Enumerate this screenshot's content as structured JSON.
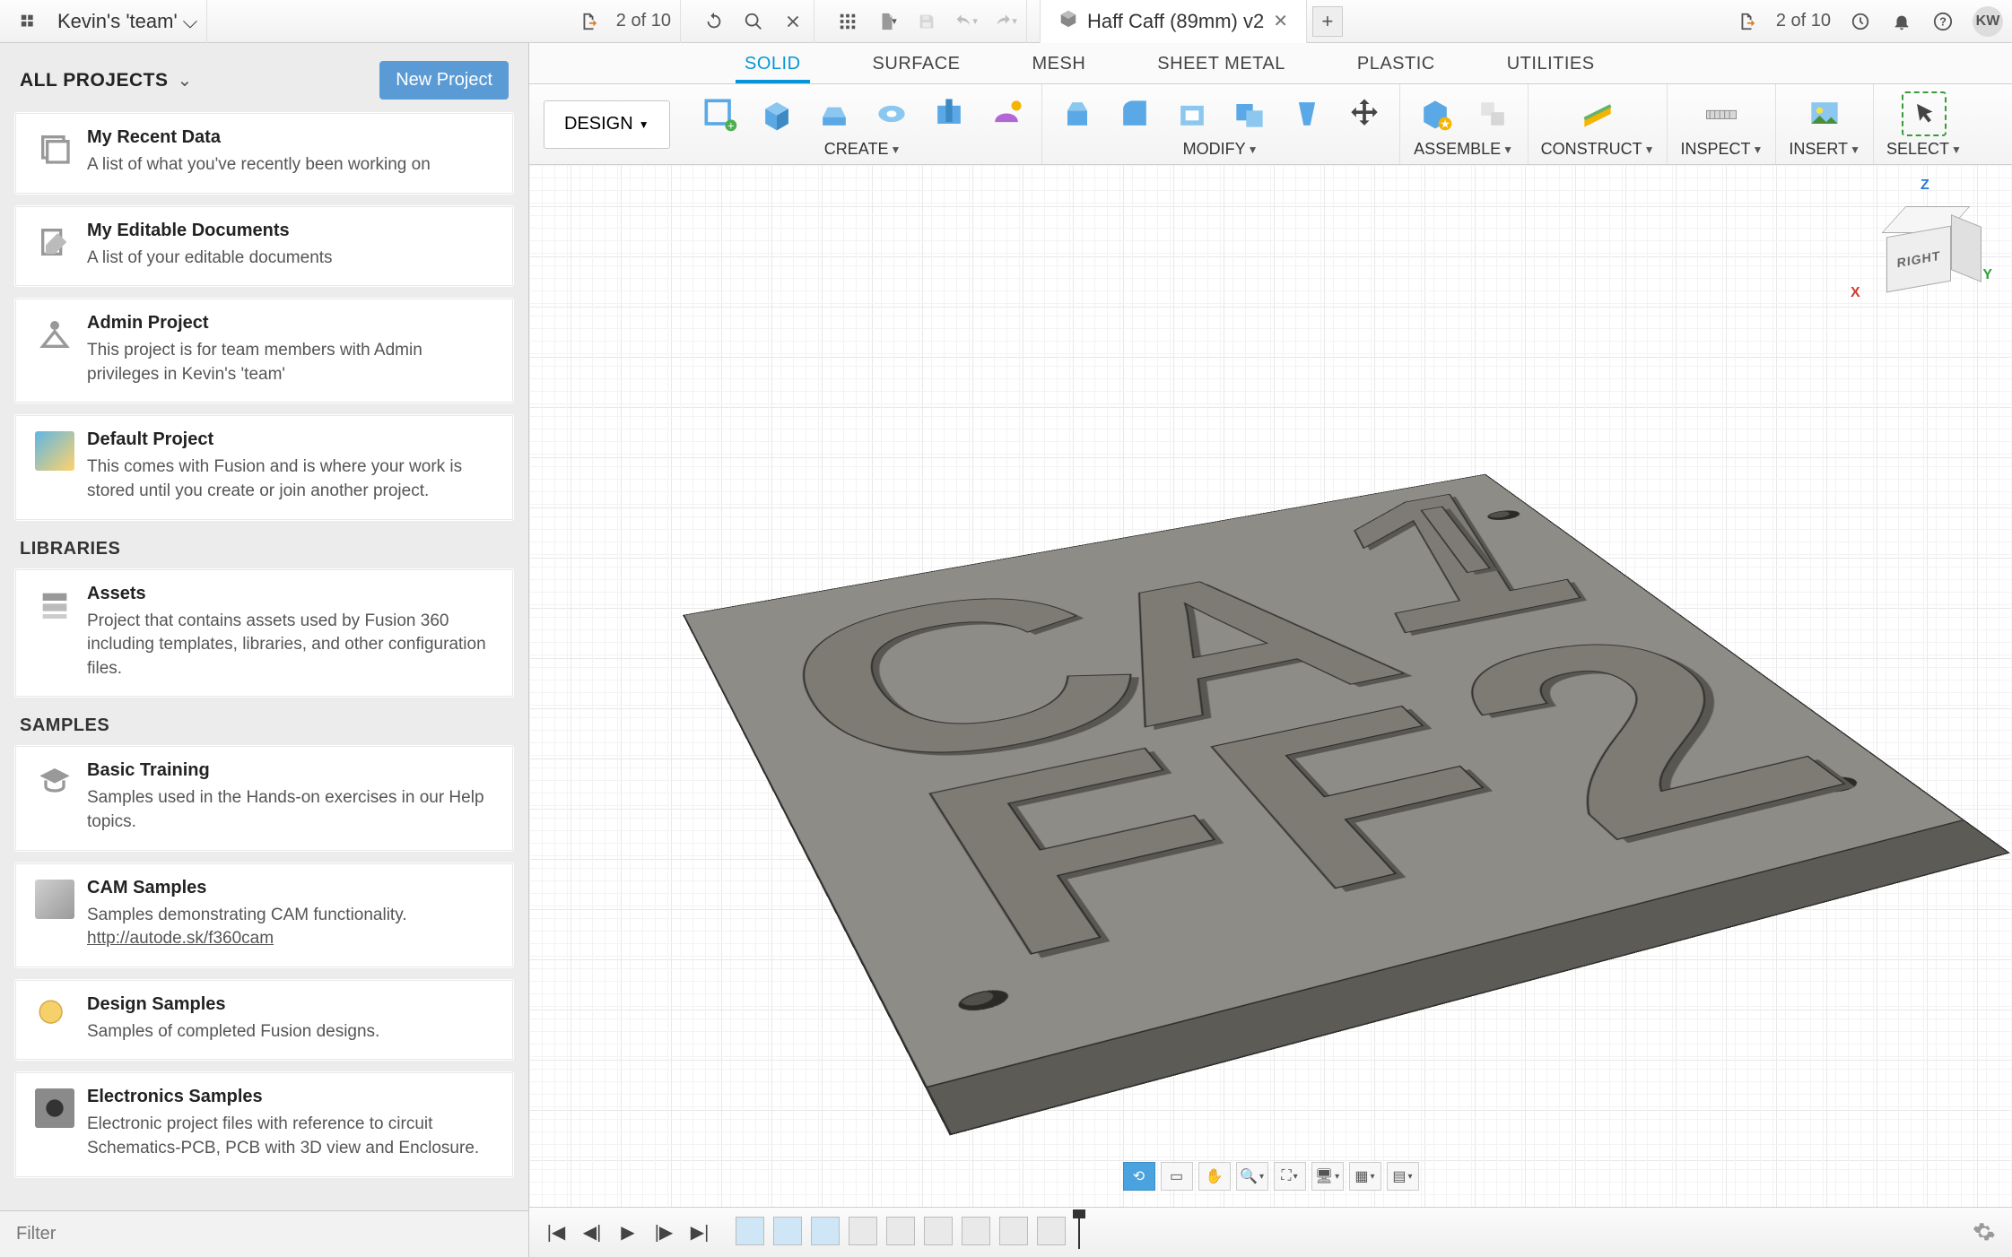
{
  "appbar": {
    "team_name": "Kevin's 'team'",
    "job_status_left": "2 of 10",
    "doc_title": "Haff Caff (89mm) v2",
    "job_status_right": "2 of 10",
    "avatar": "KW"
  },
  "sidebar": {
    "header": "ALL PROJECTS",
    "new_project": "New Project",
    "sections": {
      "projects": [
        {
          "title": "My Recent Data",
          "desc": "A list of what you've recently been working on"
        },
        {
          "title": "My Editable Documents",
          "desc": "A list of your editable documents"
        },
        {
          "title": "Admin Project",
          "desc": "This project is for team members with Admin privileges in Kevin's 'team'"
        },
        {
          "title": "Default Project",
          "desc": "This comes with Fusion and is where your work is stored until you create or join another project."
        }
      ],
      "libraries_label": "LIBRARIES",
      "libraries": [
        {
          "title": "Assets",
          "desc": "Project that contains assets used by Fusion 360 including templates, libraries, and other configuration files."
        }
      ],
      "samples_label": "SAMPLES",
      "samples": [
        {
          "title": "Basic Training",
          "desc": "Samples used in the Hands-on exercises in our Help topics."
        },
        {
          "title": "CAM Samples",
          "desc": "Samples demonstrating CAM functionality.",
          "link": "http://autode.sk/f360cam"
        },
        {
          "title": "Design Samples",
          "desc": "Samples of completed Fusion designs."
        },
        {
          "title": "Electronics Samples",
          "desc": "Electronic project files with reference to circuit Schematics-PCB, PCB with 3D view and Enclosure."
        }
      ]
    },
    "filter_placeholder": "Filter"
  },
  "workspace": {
    "tabs": [
      "SOLID",
      "SURFACE",
      "MESH",
      "SHEET METAL",
      "PLASTIC",
      "UTILITIES"
    ],
    "active_tab": "SOLID",
    "design_btn": "DESIGN",
    "groups": {
      "create": "CREATE",
      "modify": "MODIFY",
      "assemble": "ASSEMBLE",
      "construct": "CONSTRUCT",
      "inspect": "INSPECT",
      "insert": "INSERT",
      "select": "SELECT"
    },
    "navcube": {
      "front": "RIGHT"
    },
    "axes": {
      "x": "X",
      "y": "Y",
      "z": "Z"
    }
  },
  "model_text": {
    "c": "C",
    "a": "A",
    "f1": "F",
    "f2": "F",
    "one": "1",
    "slash": "/",
    "two": "2"
  }
}
